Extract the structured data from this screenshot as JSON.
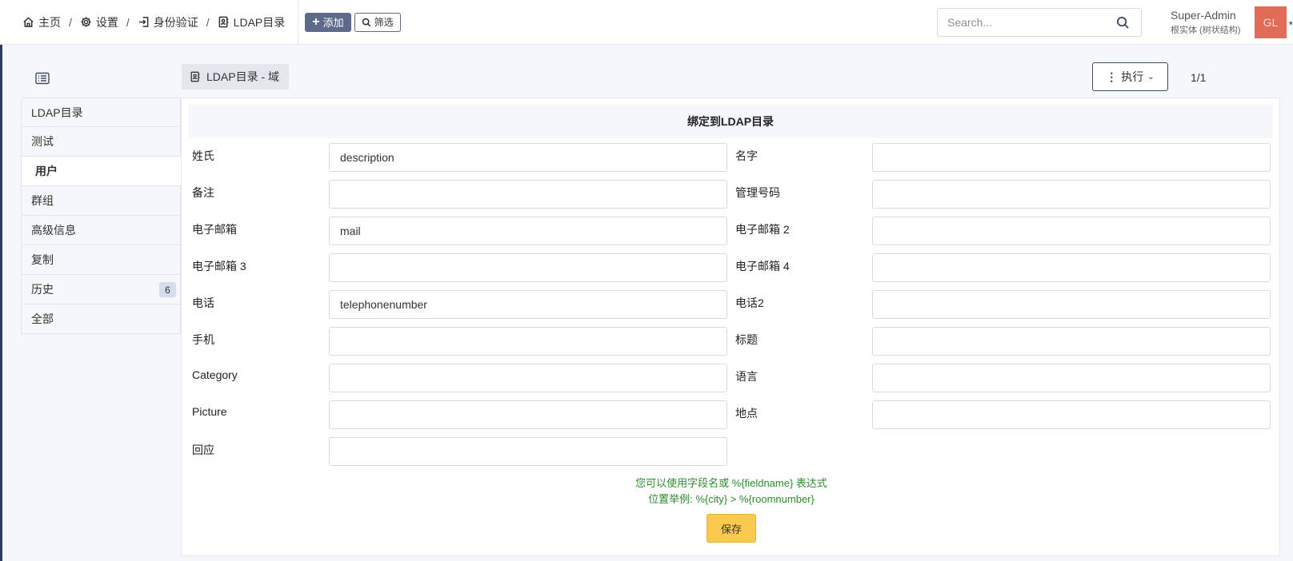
{
  "breadcrumb": {
    "home": "主页",
    "settings": "设置",
    "auth": "身份验证",
    "ldap": "LDAP目录"
  },
  "toolbar": {
    "add_label": "添加",
    "filter_label": "筛选"
  },
  "search": {
    "placeholder": "Search..."
  },
  "user": {
    "name": "Super-Admin",
    "entity": "根实体 (树状结构)",
    "initials": "GL"
  },
  "page": {
    "badge_label": "LDAP目录 - 域",
    "exec_label": "执行",
    "pager": "1/1"
  },
  "tabs": [
    {
      "label": "LDAP目录"
    },
    {
      "label": "测试"
    },
    {
      "label": "用户",
      "active": true
    },
    {
      "label": "群组"
    },
    {
      "label": "高级信息"
    },
    {
      "label": "复制"
    },
    {
      "label": "历史",
      "count": "6"
    },
    {
      "label": "全部"
    }
  ],
  "form": {
    "title": "绑定到LDAP目录",
    "fields": {
      "surname": {
        "label": "姓氏",
        "value": "description"
      },
      "firstname": {
        "label": "名字",
        "value": ""
      },
      "comment": {
        "label": "备注",
        "value": ""
      },
      "admin_number": {
        "label": "管理号码",
        "value": ""
      },
      "email": {
        "label": "电子邮箱",
        "value": "mail"
      },
      "email2": {
        "label": "电子邮箱 2",
        "value": ""
      },
      "email3": {
        "label": "电子邮箱 3",
        "value": ""
      },
      "email4": {
        "label": "电子邮箱 4",
        "value": ""
      },
      "phone": {
        "label": "电话",
        "value": "telephonenumber"
      },
      "phone2": {
        "label": "电话2",
        "value": ""
      },
      "mobile": {
        "label": "手机",
        "value": ""
      },
      "title": {
        "label": "标题",
        "value": ""
      },
      "category": {
        "label": "Category",
        "value": ""
      },
      "language": {
        "label": "语言",
        "value": ""
      },
      "picture": {
        "label": "Picture",
        "value": ""
      },
      "location": {
        "label": "地点",
        "value": ""
      },
      "responsible": {
        "label": "回应",
        "value": ""
      }
    },
    "hint_line1": "您可以使用字段名或 %{fieldname} 表达式",
    "hint_line2": "位置举例: %{city} > %{roomnumber}",
    "save_label": "保存"
  },
  "colors": {
    "accent": "#5d6a8a",
    "save_button": "#fcc94f",
    "hint_text": "#2e8b2e",
    "avatar": "#e06b57"
  }
}
